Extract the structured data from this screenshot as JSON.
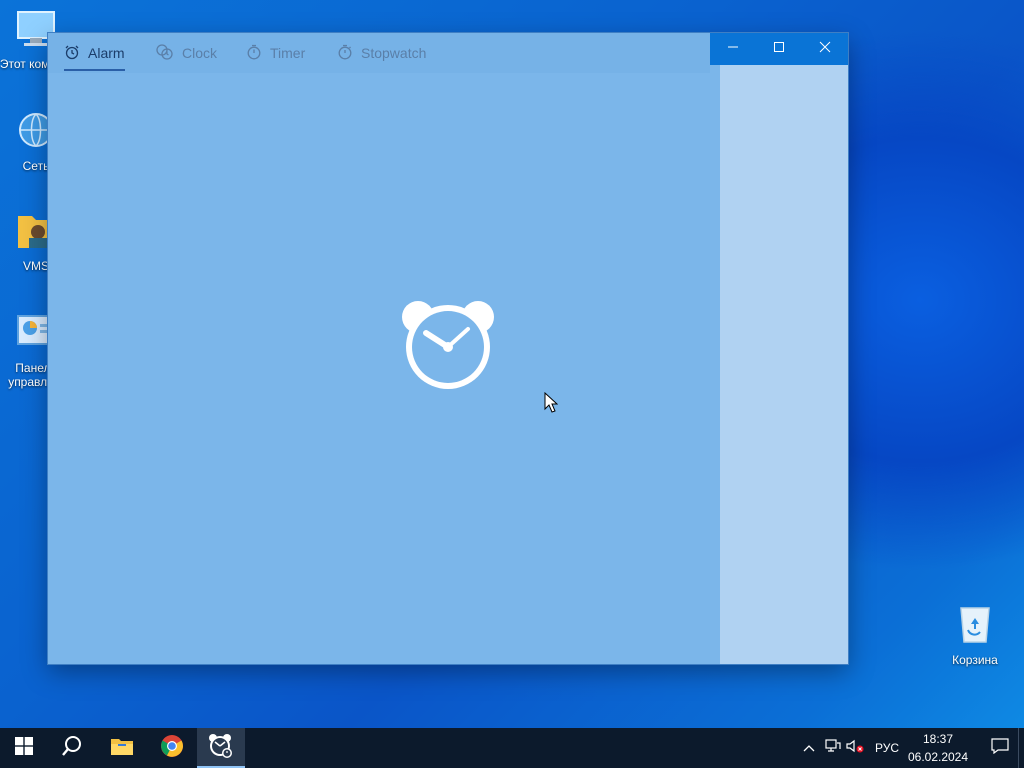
{
  "desktop": {
    "icons": [
      {
        "label": "Этот компь...",
        "icon": "computer-icon"
      },
      {
        "label": "Сеть",
        "icon": "network-icon"
      },
      {
        "label": "VMS",
        "icon": "user-folder-icon"
      },
      {
        "label": "Панель управле...",
        "icon": "control-panel-icon"
      },
      {
        "label": "Корзина",
        "icon": "recycle-bin-icon"
      }
    ]
  },
  "app": {
    "tabs": [
      {
        "label": "Alarm",
        "icon": "alarm-icon",
        "active": true
      },
      {
        "label": "Clock",
        "icon": "world-clock-icon",
        "active": false
      },
      {
        "label": "Timer",
        "icon": "timer-icon",
        "active": false
      },
      {
        "label": "Stopwatch",
        "icon": "stopwatch-icon",
        "active": false
      }
    ],
    "window_controls": [
      "minimize",
      "maximize",
      "close"
    ],
    "hero_icon": "alarm-clock-icon"
  },
  "taskbar": {
    "items": [
      "start",
      "search",
      "file-explorer",
      "chrome",
      "alarms-clock"
    ],
    "active_item": "alarms-clock",
    "tray": {
      "language": "РУС",
      "time": "18:37",
      "date": "06.02.2024"
    }
  },
  "colors": {
    "accent": "#0a74d6",
    "window_bg": "#7bb6ea",
    "side_panel": "#b0d2f2",
    "taskbar": "#0c1a2c"
  }
}
